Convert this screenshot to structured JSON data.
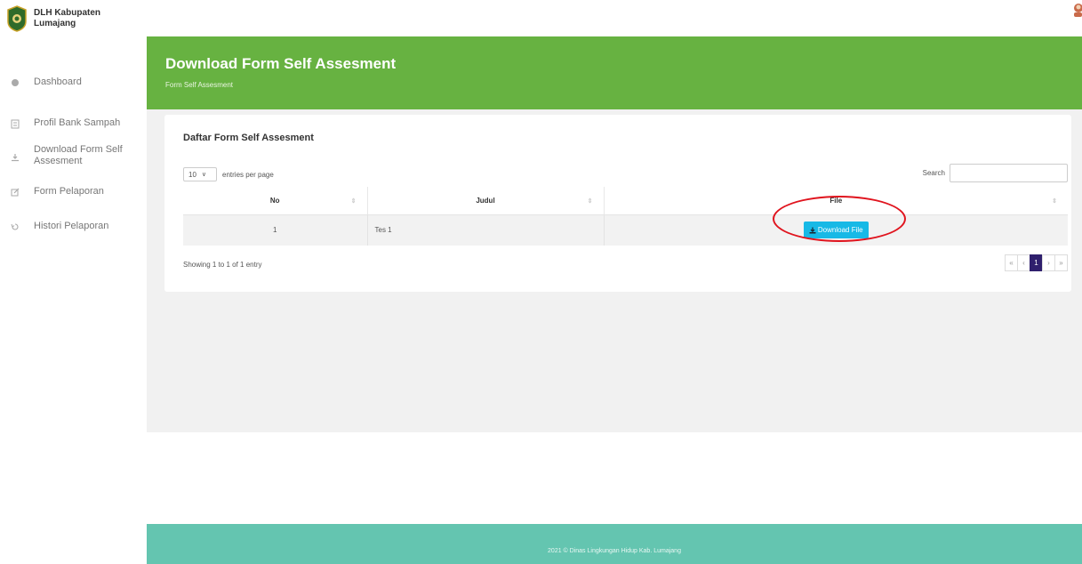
{
  "brand": {
    "line1": "DLH Kabupaten",
    "line2": "Lumajang"
  },
  "sidebar": {
    "items": [
      {
        "label": "Dashboard",
        "icon": "dashboard-icon"
      },
      {
        "label": "Profil Bank Sampah",
        "icon": "profile-icon"
      },
      {
        "label": "Download Form Self Assesment",
        "icon": "download-icon"
      },
      {
        "label": "Form Pelaporan",
        "icon": "edit-icon"
      },
      {
        "label": "Histori Pelaporan",
        "icon": "history-icon"
      }
    ]
  },
  "header": {
    "title": "Download Form Self Assesment",
    "breadcrumb": "Form Self Assesment"
  },
  "card": {
    "title": "Daftar Form Self Assesment"
  },
  "table_controls": {
    "entries_value": "10",
    "entries_label": "entries per page",
    "search_label": "Search",
    "search_value": ""
  },
  "table": {
    "headers": [
      "No",
      "Judul",
      "File"
    ],
    "rows": [
      {
        "no": "1",
        "judul": "Tes 1",
        "file_button": "Download File"
      }
    ]
  },
  "info": "Showing 1 to 1 of 1 entry",
  "pagination": {
    "first": "«",
    "prev": "‹",
    "current": "1",
    "next": "›",
    "last": "»"
  },
  "footer": {
    "text": "2021 © Dinas Lingkungan Hidup Kab. Lumajang"
  },
  "colors": {
    "header": "#67b241",
    "footer": "#64c5b0",
    "button": "#17b9e6",
    "pager_active": "#2f1f6d",
    "highlight": "#e0141e"
  }
}
